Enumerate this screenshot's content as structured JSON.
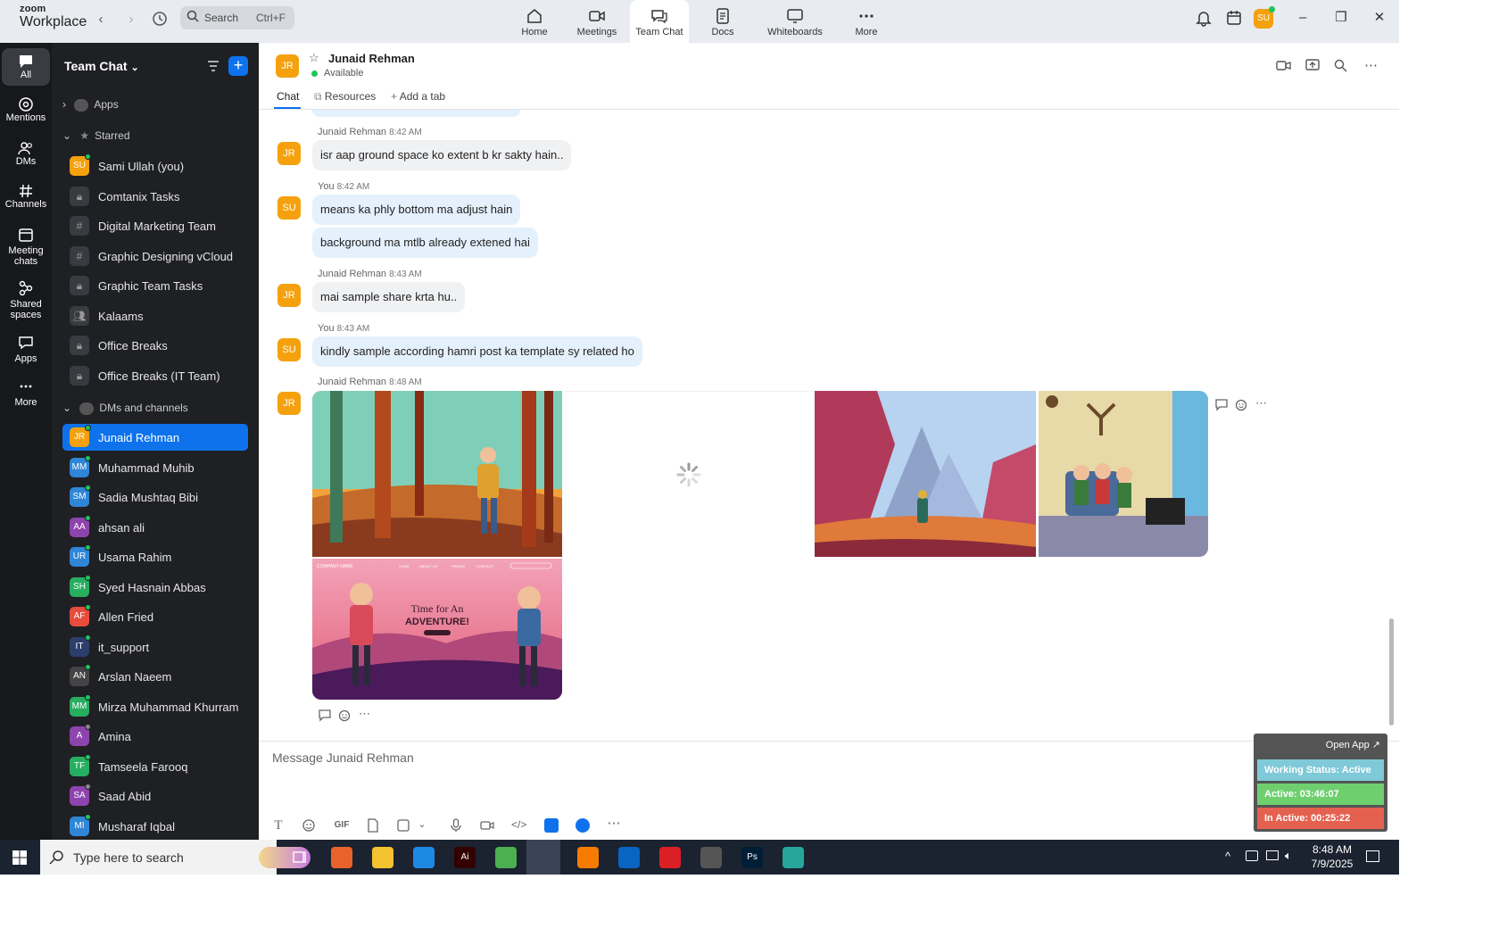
{
  "app": {
    "logo_line1": "zoom",
    "logo_line2": "Workplace",
    "search_label": "Search",
    "search_shortcut": "Ctrl+F",
    "self_initials": "SU"
  },
  "top_tabs": [
    {
      "label": "Home",
      "icon": "home-icon"
    },
    {
      "label": "Meetings",
      "icon": "camera-icon"
    },
    {
      "label": "Team Chat",
      "icon": "chat-icon"
    },
    {
      "label": "Docs",
      "icon": "doc-icon"
    },
    {
      "label": "Whiteboards",
      "icon": "whiteboard-icon"
    },
    {
      "label": "More",
      "icon": "more-icon"
    }
  ],
  "rail": [
    {
      "label": "All",
      "icon": "chat-bubble-icon"
    },
    {
      "label": "Mentions",
      "icon": "at-icon"
    },
    {
      "label": "DMs",
      "icon": "people-icon"
    },
    {
      "label": "Channels",
      "icon": "hash-icon"
    },
    {
      "label": "Meeting chats",
      "icon": "calendar-icon"
    },
    {
      "label": "Shared spaces",
      "icon": "share-icon"
    },
    {
      "label": "Apps",
      "icon": "apps-icon"
    },
    {
      "label": "More",
      "icon": "dots-icon"
    }
  ],
  "sidebar": {
    "title": "Team Chat",
    "apps_label": "Apps",
    "starred_label": "Starred",
    "dms_label": "DMs and channels",
    "starred": [
      {
        "label": "Sami Ullah (you)",
        "initials": "SU",
        "color": "#f4a10d",
        "kind": "user"
      },
      {
        "label": "Comtanix Tasks",
        "kind": "lock"
      },
      {
        "label": "Digital Marketing Team",
        "kind": "hash"
      },
      {
        "label": "Graphic Designing vCloud",
        "kind": "hash"
      },
      {
        "label": "Graphic Team Tasks",
        "kind": "lock"
      },
      {
        "label": "Kalaams",
        "kind": "group"
      },
      {
        "label": "Office Breaks",
        "kind": "lock"
      },
      {
        "label": "Office Breaks (IT Team)",
        "kind": "lock"
      }
    ],
    "dms": [
      {
        "label": "Junaid Rehman",
        "initials": "JR",
        "color": "#f4a10d",
        "status": "on"
      },
      {
        "label": "Muhammad Muhib",
        "initials": "MM",
        "color": "#2f86d6",
        "status": "on"
      },
      {
        "label": "Sadia Mushtaq Bibi",
        "initials": "SM",
        "color": "#2f86d6",
        "status": "on"
      },
      {
        "label": "ahsan ali",
        "initials": "AA",
        "color": "#8e44ad",
        "status": "on"
      },
      {
        "label": "Usama Rahim",
        "initials": "UR",
        "color": "#2f86d6",
        "status": "on"
      },
      {
        "label": "Syed Hasnain Abbas",
        "initials": "SH",
        "color": "#27ae60",
        "status": "on"
      },
      {
        "label": "Allen Fried",
        "initials": "AF",
        "color": "#e74c3c",
        "status": "on"
      },
      {
        "label": "it_support",
        "initials": "IT",
        "color": "#2c3e6b",
        "status": "on"
      },
      {
        "label": "Arslan Naeem",
        "initials": "AN",
        "color": "#444444",
        "status": "on"
      },
      {
        "label": "Mirza Muhammad Khurram",
        "initials": "MM",
        "color": "#27ae60",
        "status": "on"
      },
      {
        "label": "Amina",
        "initials": "A",
        "color": "#8e44ad",
        "status": "off"
      },
      {
        "label": "Tamseela Farooq",
        "initials": "TF",
        "color": "#27ae60",
        "status": "on"
      },
      {
        "label": "Saad Abid",
        "initials": "SA",
        "color": "#8e44ad",
        "status": "off"
      },
      {
        "label": "Musharaf Iqbal",
        "initials": "MI",
        "color": "#2f86d6",
        "status": "on"
      }
    ]
  },
  "chat": {
    "contact_name": "Junaid Rehman",
    "contact_initials": "JR",
    "status": "Available",
    "tabs": [
      "Chat",
      "Resources",
      "Add a tab"
    ],
    "messages": [
      {
        "sender": "Junaid Rehman",
        "time": "8:42 AM",
        "text": "isr aap ground space ko extent b kr sakty hain.."
      },
      {
        "sender": "You",
        "time": "8:42 AM",
        "text": "means ka phly bottom ma adjust hain"
      },
      {
        "text": "background ma mtlb already extened hai"
      },
      {
        "sender": "Junaid Rehman",
        "time": "8:43 AM",
        "text": "mai sample share krta hu.."
      },
      {
        "sender": "You",
        "time": "8:43 AM",
        "text": "kindly sample according hamri post ka template sy related ho"
      },
      {
        "sender": "Junaid Rehman",
        "time": "8:48 AM"
      }
    ],
    "image_texts": {
      "brand": "COMPANY NAME",
      "nav": [
        "HOME",
        "ABOUT US",
        "PRICES",
        "CONTACT"
      ],
      "headline1": "Time for An",
      "headline2": "ADVENTURE!"
    },
    "composer_placeholder": "Message Junaid Rehman",
    "gif_label": "GIF"
  },
  "widget": {
    "open_label": "Open App ↗",
    "working_status": "Working Status: Active",
    "active": "Active: 03:46:07",
    "inactive": "In Active: 00:25:22",
    "colors": {
      "status": "#7fc9d8",
      "active": "#6fcf6f",
      "inactive": "#e5614f"
    }
  },
  "taskbar": {
    "search_placeholder": "Type here to search",
    "time": "8:48 AM",
    "date": "7/9/2025",
    "apps": [
      {
        "name": "firefox-icon",
        "color": "#e8622c"
      },
      {
        "name": "file-explorer-icon",
        "color": "#f2c230"
      },
      {
        "name": "vscode-icon",
        "color": "#1e88e5"
      },
      {
        "name": "illustrator-icon",
        "color": "#330000",
        "text": "Ai"
      },
      {
        "name": "chrome-icon",
        "color": "#4caf50"
      },
      {
        "name": "zoom-icon",
        "color": "#2d8cff",
        "text": "zm"
      },
      {
        "name": "xampp-icon",
        "color": "#f57c00"
      },
      {
        "name": "outlook-icon",
        "color": "#0a64c2"
      },
      {
        "name": "creative-cloud-icon",
        "color": "#da1f26"
      },
      {
        "name": "pen-tool-icon",
        "color": "#555555"
      },
      {
        "name": "photoshop-icon",
        "color": "#001e36",
        "text": "Ps"
      },
      {
        "name": "app-diamond-icon",
        "color": "#26a69a"
      }
    ]
  }
}
